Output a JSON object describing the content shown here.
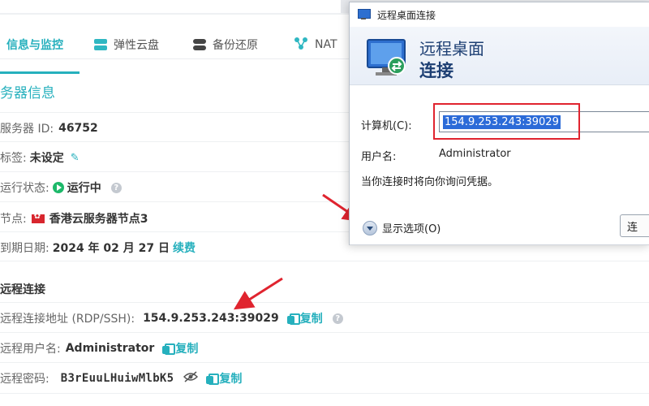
{
  "tabs": [
    {
      "label": "信息与监控",
      "active": true
    },
    {
      "label": "弹性云盘",
      "icon": "disk-icon"
    },
    {
      "label": "备份还原",
      "icon": "database-icon"
    },
    {
      "label": "NAT",
      "icon": "network-icon"
    }
  ],
  "server_info": {
    "title": "务器信息",
    "id_label": "服务器 ID:",
    "id_value": "46752",
    "tag_label": "标签:",
    "tag_value": "未设定",
    "status_label": "运行状态:",
    "status_value": "运行中",
    "node_label": "节点:",
    "node_value": "香港云服务器节点3",
    "expiry_label": "到期日期:",
    "expiry_value": "2024 年 02 月 27 日",
    "renew_label": "续费"
  },
  "remote": {
    "title": "远程连接",
    "address_label": "远程连接地址 (RDP/SSH):",
    "address_value": "154.9.253.243:39029",
    "user_label": "远程用户名:",
    "user_value": "Administrator",
    "password_label": "远程密码:",
    "password_value": "B3rEuuLHuiwMlbK5",
    "copy_label": "复制"
  },
  "dialog": {
    "window_title": "远程桌面连接",
    "heading_line1": "远程桌面",
    "heading_line2": "连接",
    "computer_label": "计算机(C):",
    "computer_value": "154.9.253.243:39029",
    "username_label": "用户名:",
    "username_value": "Administrator",
    "note": "当你连接时将向你询问凭据。",
    "show_options_label": "显示选项(O)",
    "connect_label": "连"
  },
  "colors": {
    "accent": "#26b0bd",
    "annotation": "#e0242f",
    "status_running": "#1db96a"
  }
}
